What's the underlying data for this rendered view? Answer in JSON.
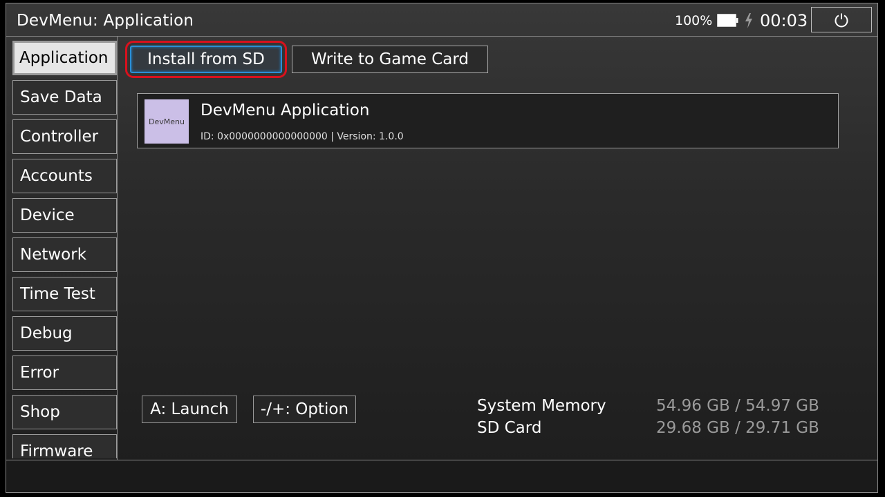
{
  "header": {
    "title": "DevMenu: Application",
    "battery_percent": "100%",
    "battery_level": 1.0,
    "charging": true,
    "clock": "00:03"
  },
  "sidebar": {
    "items": [
      {
        "label": "Application",
        "selected": true
      },
      {
        "label": "Save Data"
      },
      {
        "label": "Controller"
      },
      {
        "label": "Accounts"
      },
      {
        "label": "Device"
      },
      {
        "label": "Network"
      },
      {
        "label": "Time Test"
      },
      {
        "label": "Debug"
      },
      {
        "label": "Error"
      },
      {
        "label": "Shop"
      },
      {
        "label": "Firmware"
      }
    ]
  },
  "toolbar": {
    "install_sd_label": "Install from SD",
    "write_gc_label": "Write to Game Card"
  },
  "application": {
    "thumb_text": "DevMenu",
    "thumb_color": "#cbbfe7",
    "name": "DevMenu Application",
    "meta": "ID: 0x0000000000000000 | Version: 1.0.0"
  },
  "hints": {
    "launch": "A: Launch",
    "option": "-/+: Option"
  },
  "storage": {
    "system_label": "System Memory",
    "system_value": "54.96 GB / 54.97 GB",
    "sd_label": "SD Card",
    "sd_value": "29.68 GB / 29.71 GB"
  },
  "colors": {
    "highlight_ring": "#d9111d",
    "focus_blue": "#2b8fd6"
  }
}
